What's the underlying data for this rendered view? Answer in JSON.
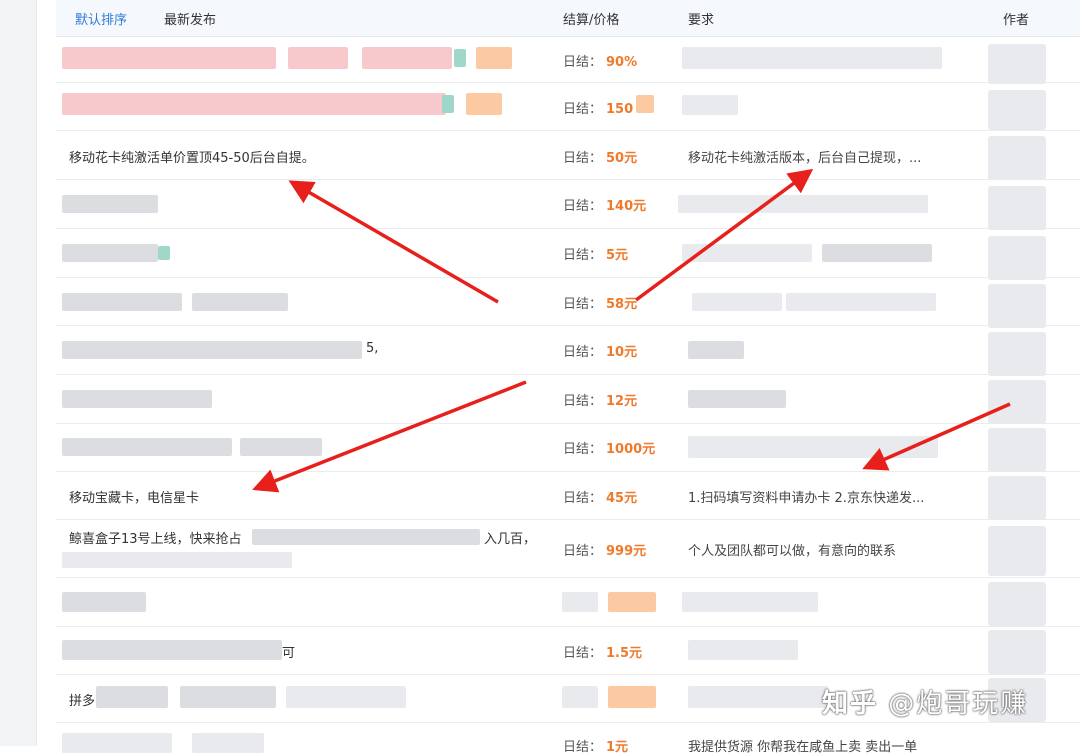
{
  "header": {
    "tab_default": "默认排序",
    "tab_latest": "最新发布",
    "col_price": "结算/价格",
    "col_requirement": "要求",
    "col_author": "作者"
  },
  "price_prefix": "日结：",
  "rows": [
    {
      "title": "",
      "price": "90%",
      "requirement": ""
    },
    {
      "title": "",
      "price": "150",
      "requirement": ""
    },
    {
      "title": "移动花卡纯激活单价置顶45-50后台自提。",
      "price": "50元",
      "requirement": "移动花卡纯激活版本，后台自己提现，..."
    },
    {
      "title": "",
      "price": "140元",
      "requirement": ""
    },
    {
      "title": "",
      "price": "5元",
      "requirement": ""
    },
    {
      "title": "",
      "price": "58元",
      "requirement": ""
    },
    {
      "title": "",
      "title_tail": "5,",
      "price": "10元",
      "requirement": ""
    },
    {
      "title": "",
      "price": "12元",
      "requirement": ""
    },
    {
      "title": "",
      "price": "1000元",
      "requirement": ""
    },
    {
      "title": "移动宝藏卡，电信星卡",
      "price": "45元",
      "requirement": "1.扫码填写资料申请办卡 2.京东快递发..."
    },
    {
      "title_part1": "鲸喜盒子13号上线，快来抢占",
      "title_part2": "入几百，",
      "price": "999元",
      "requirement": "个人及团队都可以做，有意向的联系"
    },
    {
      "title": "",
      "price": "",
      "requirement": ""
    },
    {
      "title": "",
      "title_tail": "可",
      "price": "1.5元",
      "requirement": ""
    },
    {
      "title_head": "拼多",
      "price": "",
      "requirement": ""
    },
    {
      "title": "",
      "price": "1元",
      "requirement": "我提供货源 你帮我在咸鱼上卖 卖出一单"
    }
  ],
  "watermark": {
    "brand": "知乎",
    "handle": "@炮哥玩赚"
  },
  "colors": {
    "accent_blue": "#2f7ad9",
    "price_orange": "#ee7a2b",
    "arrow_red": "#e8201c"
  }
}
